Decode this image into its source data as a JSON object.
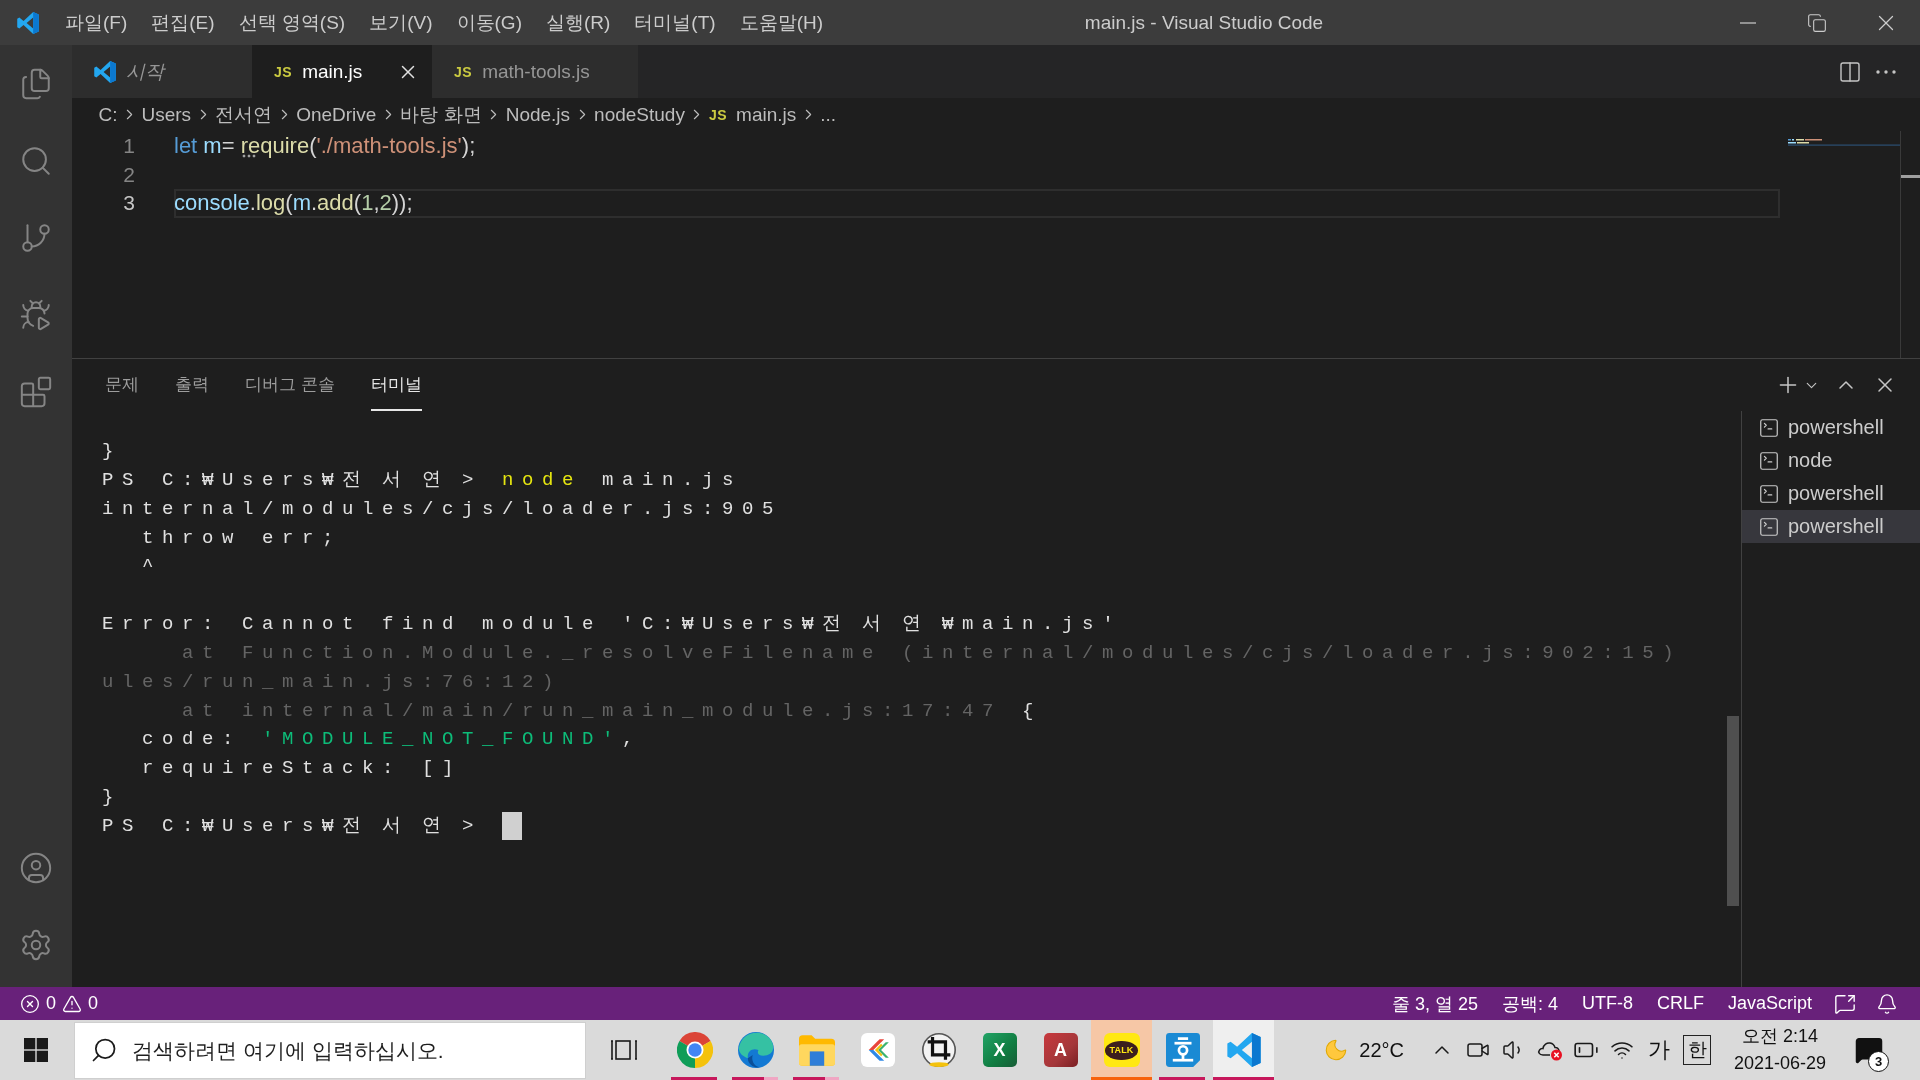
{
  "window": {
    "title": "main.js - Visual Studio Code"
  },
  "menu": [
    "파일(F)",
    "편집(E)",
    "선택 영역(S)",
    "보기(V)",
    "이동(G)",
    "실행(R)",
    "터미널(T)",
    "도움말(H)"
  ],
  "activity_bar": {
    "top": [
      {
        "kind": "explorer",
        "selected": false
      },
      {
        "kind": "search",
        "selected": false
      },
      {
        "kind": "source-control",
        "selected": false
      },
      {
        "kind": "run",
        "selected": false
      },
      {
        "kind": "extensions",
        "selected": false
      }
    ],
    "bottom": [
      {
        "kind": "accounts",
        "selected": false
      },
      {
        "kind": "settings",
        "selected": false
      }
    ]
  },
  "tabs": [
    {
      "kind": "welcome",
      "label": "시작",
      "preview": true,
      "selected": false
    },
    {
      "kind": "js",
      "badge": "JS",
      "label": "main.js",
      "preview": false,
      "selected": true
    },
    {
      "kind": "js",
      "badge": "JS",
      "label": "math-tools.js",
      "preview": false,
      "selected": false
    }
  ],
  "breadcrumb": [
    {
      "label": "C:"
    },
    {
      "label": "Users"
    },
    {
      "label": "전서연"
    },
    {
      "label": "OneDrive"
    },
    {
      "label": "바탕 화면"
    },
    {
      "label": "Node.js"
    },
    {
      "label": "nodeStudy"
    },
    {
      "label": "main.js",
      "badge": "JS"
    },
    {
      "label": "..."
    }
  ],
  "editor": {
    "lines": [
      {
        "number": "1",
        "current": false,
        "tokens": [
          {
            "text": "let ",
            "kind": "keyword"
          },
          {
            "text": "m",
            "kind": "variable"
          },
          {
            "text": "= ",
            "kind": "plain"
          },
          {
            "text": "require",
            "kind": "function",
            "hint": true
          },
          {
            "text": "(",
            "kind": "plain"
          },
          {
            "text": "'./math-tools.js'",
            "kind": "string"
          },
          {
            "text": ");",
            "kind": "plain"
          }
        ]
      },
      {
        "number": "2",
        "current": false
      },
      {
        "number": "3",
        "current": true,
        "tokens": [
          {
            "text": "console",
            "kind": "variable"
          },
          {
            "text": ".",
            "kind": "plain"
          },
          {
            "text": "log",
            "kind": "function"
          },
          {
            "text": "(",
            "kind": "plain"
          },
          {
            "text": "m",
            "kind": "variable"
          },
          {
            "text": ".",
            "kind": "plain"
          },
          {
            "text": "add",
            "kind": "function"
          },
          {
            "text": "(",
            "kind": "plain"
          },
          {
            "text": "1",
            "kind": "number"
          },
          {
            "text": ",",
            "kind": "plain"
          },
          {
            "text": "2",
            "kind": "number"
          },
          {
            "text": "));",
            "kind": "plain"
          }
        ]
      }
    ]
  },
  "panel": {
    "tabs": [
      {
        "label": "문제",
        "selected": false
      },
      {
        "label": "출력",
        "selected": false
      },
      {
        "label": "디버그 콘솔",
        "selected": false
      },
      {
        "label": "터미널",
        "selected": true
      }
    ],
    "terminal": {
      "lines": [
        {
          "kind": "text",
          "segments": [
            {
              "text": "}",
              "kind": "plain"
            }
          ]
        },
        {
          "kind": "text",
          "segments": [
            {
              "text": "PS C:₩Users₩전 서 연 > ",
              "kind": "plain"
            },
            {
              "text": "node",
              "kind": "command"
            },
            {
              "text": " main.js",
              "kind": "plain"
            }
          ]
        },
        {
          "kind": "text",
          "segments": [
            {
              "text": "internal/modules/cjs/loader.js:905",
              "kind": "plain"
            }
          ]
        },
        {
          "kind": "text",
          "segments": [
            {
              "text": "  throw err;",
              "kind": "plain"
            }
          ]
        },
        {
          "kind": "text",
          "segments": [
            {
              "text": "  ^",
              "kind": "plain"
            }
          ]
        },
        {
          "kind": "blank"
        },
        {
          "kind": "text",
          "segments": [
            {
              "text": "Error: Cannot find module 'C:₩Users₩전 서 연 ₩main.js'",
              "kind": "plain"
            }
          ]
        },
        {
          "kind": "text",
          "segments": [
            {
              "text": "    at Function.Module._resolveFilename (internal/modules/cjs/loader.js:902:15)",
              "kind": "dim"
            }
          ]
        },
        {
          "kind": "text",
          "segments": [
            {
              "text": "ules/run_main.js:76:12)",
              "kind": "dim"
            }
          ]
        },
        {
          "kind": "text",
          "segments": [
            {
              "text": "    at internal/main/run_main_module.js:17:47",
              "kind": "dim"
            },
            {
              "text": " {",
              "kind": "plain"
            }
          ]
        },
        {
          "kind": "text",
          "segments": [
            {
              "text": "  code: ",
              "kind": "plain"
            },
            {
              "text": "'MODULE_NOT_FOUND'",
              "kind": "string"
            },
            {
              "text": ",",
              "kind": "plain"
            }
          ]
        },
        {
          "kind": "text",
          "segments": [
            {
              "text": "  requireStack: []",
              "kind": "plain"
            }
          ]
        },
        {
          "kind": "text",
          "segments": [
            {
              "text": "}",
              "kind": "plain"
            }
          ]
        },
        {
          "kind": "text",
          "cursor": true,
          "segments": [
            {
              "text": "PS C:₩Users₩전 서 연 >",
              "kind": "plain"
            }
          ]
        }
      ]
    },
    "terminal_list": [
      {
        "label": "powershell",
        "selected": false
      },
      {
        "label": "node",
        "selected": false
      },
      {
        "label": "powershell",
        "selected": false
      },
      {
        "label": "powershell",
        "selected": true
      }
    ]
  },
  "status_bar": {
    "problems": {
      "errors": "0",
      "warnings": "0"
    },
    "items": [
      "줄 3, 열 25",
      "공백: 4",
      "UTF-8",
      "CRLF",
      "JavaScript"
    ]
  },
  "taskbar": {
    "search": {
      "placeholder": "검색하려면 여기에 입력하십시오."
    },
    "apps": [
      {
        "kind": "chrome",
        "running": true,
        "stacked": false,
        "active": false,
        "flashing": false
      },
      {
        "kind": "edge",
        "running": true,
        "stacked": true,
        "active": false,
        "flashing": false
      },
      {
        "kind": "explorer",
        "running": true,
        "stacked": true,
        "active": false,
        "flashing": false
      },
      {
        "kind": "arrows",
        "running": false,
        "active": false,
        "flashing": false
      },
      {
        "kind": "cropper",
        "running": false,
        "active": false,
        "flashing": false
      },
      {
        "kind": "excel",
        "icon_text": "X",
        "running": false,
        "active": false,
        "flashing": false
      },
      {
        "kind": "access",
        "icon_text": "A",
        "running": false,
        "active": false,
        "flashing": false
      },
      {
        "kind": "kakao",
        "icon_text": "TALK",
        "running": true,
        "stacked": false,
        "active": false,
        "flashing": true
      },
      {
        "kind": "hangul",
        "running": true,
        "stacked": false,
        "active": false,
        "flashing": false
      },
      {
        "kind": "vscode",
        "running": true,
        "stacked": false,
        "active": true,
        "flashing": false
      }
    ],
    "weather": {
      "temperature": "22°C"
    },
    "tray_icons": [
      {
        "kind": "chevron"
      },
      {
        "kind": "camera"
      },
      {
        "kind": "speaker"
      },
      {
        "kind": "cloud-error"
      },
      {
        "kind": "battery"
      },
      {
        "kind": "wifi"
      }
    ],
    "ime": [
      {
        "text": "가",
        "kind": "plain"
      },
      {
        "text": "한",
        "kind": "boxed"
      }
    ],
    "clock": {
      "time": "오전 2:14",
      "date": "2021-06-29"
    },
    "notifications": {
      "count": "3"
    }
  }
}
